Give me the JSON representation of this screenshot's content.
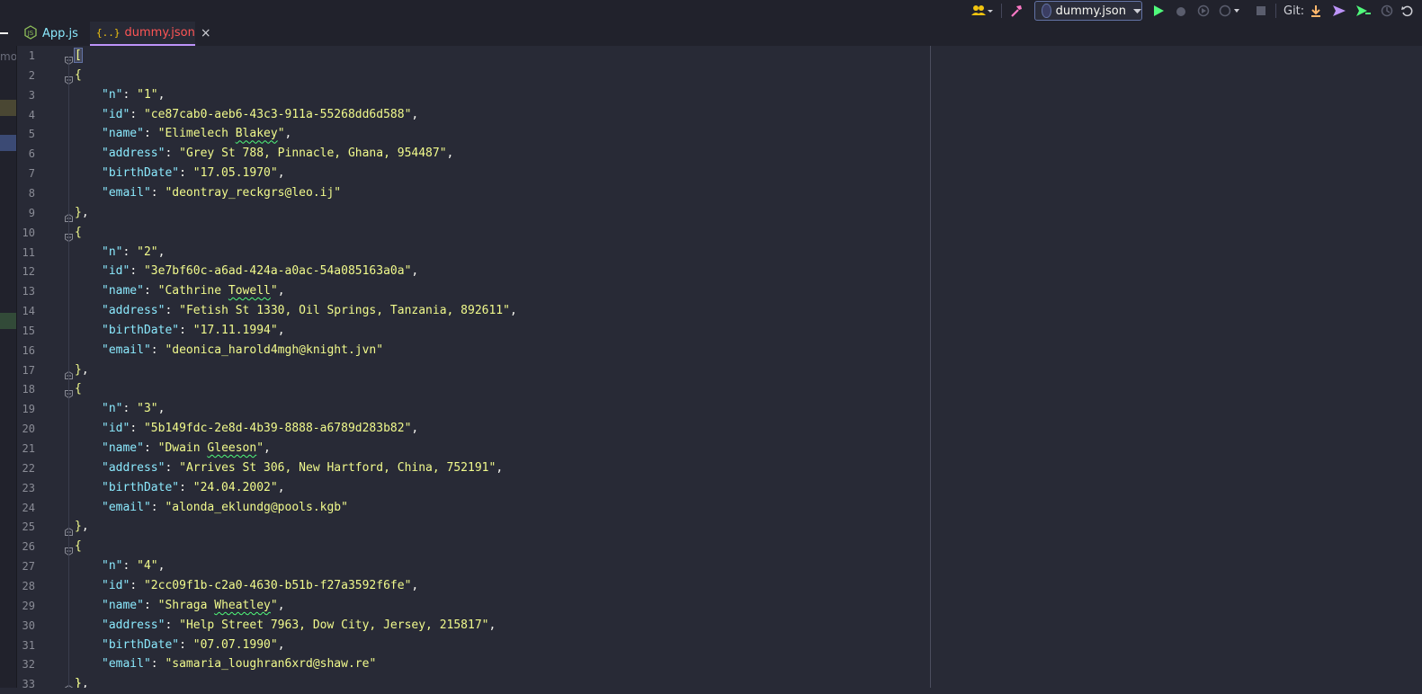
{
  "toolbar": {
    "run_config": "dummy.json",
    "git_label": "Git:"
  },
  "left_strip": {
    "label": "mo"
  },
  "tabs": [
    {
      "label": "App.js",
      "icon": "js-file-icon",
      "active": false
    },
    {
      "label": "dummy.json",
      "icon": "json-file-icon",
      "active": true,
      "close": "×"
    }
  ],
  "line_numbers": [
    "1",
    "2",
    "3",
    "4",
    "5",
    "6",
    "7",
    "8",
    "9",
    "10",
    "11",
    "12",
    "13",
    "14",
    "15",
    "16",
    "17",
    "18",
    "19",
    "20",
    "21",
    "22",
    "23",
    "24",
    "25",
    "26",
    "27",
    "28",
    "29",
    "30",
    "31",
    "32",
    "33"
  ],
  "records": [
    {
      "n": "1",
      "id": "ce87cab0-aeb6-43c3-911a-55268dd6d588",
      "name_first": "Elimelech",
      "name_last": "Blakey",
      "address": "Grey St 788, Pinnacle, Ghana, 954487",
      "birthDate": "17.05.1970",
      "email": "deontray_reckgrs@leo.ij"
    },
    {
      "n": "2",
      "id": "3e7bf60c-a6ad-424a-a0ac-54a085163a0a",
      "name_first": "Cathrine",
      "name_last": "Towell",
      "address": "Fetish St 1330, Oil Springs, Tanzania, 892611",
      "birthDate": "17.11.1994",
      "email": "deonica_harold4mgh@knight.jvn"
    },
    {
      "n": "3",
      "id": "5b149fdc-2e8d-4b39-8888-a6789d283b82",
      "name_first": "Dwain",
      "name_last": "Gleeson",
      "address": "Arrives St 306, New Hartford, China, 752191",
      "birthDate": "24.04.2002",
      "email": "alonda_eklundg@pools.kgb"
    },
    {
      "n": "4",
      "id": "2cc09f1b-c2a0-4630-b51b-f27a3592f6fe",
      "name_first": "Shraga",
      "name_last": "Wheatley",
      "address": "Help Street 7963, Dow City, Jersey, 215817",
      "birthDate": "07.07.1990",
      "email": "samaria_loughran6xrd@shaw.re"
    }
  ],
  "colors": {
    "background": "#282a36",
    "key": "#8be9fd",
    "string": "#f1fa8c",
    "active_tab": "#ff5555"
  }
}
